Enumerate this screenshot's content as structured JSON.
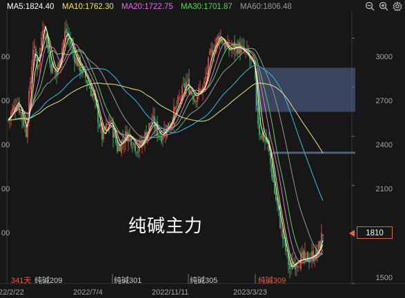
{
  "legend": {
    "ma5": {
      "label": "MA5:1824.40",
      "color": "#ffffff"
    },
    "ma10": {
      "label": "MA10:1762.30",
      "color": "#f5e94e"
    },
    "ma20": {
      "label": "MA20:1722.75",
      "color": "#e46de8"
    },
    "ma30": {
      "label": "MA30:1701.87",
      "color": "#5fd35a"
    },
    "ma60": {
      "label": "MA60:1806.48",
      "color": "#9a9a9a"
    }
  },
  "toolbar": {
    "icons": [
      "zoom-out-icon",
      "zoom-in-icon",
      "settings-icon"
    ]
  },
  "watermark": "纯碱主力",
  "price_tag": "1810",
  "days_label": "341天",
  "contracts": [
    "纯碱209",
    "纯碱301",
    "纯碱305",
    "纯碱309"
  ],
  "colors": {
    "up": "#ff4d4d",
    "down": "#36c66f",
    "highlight": "#f05a3a",
    "ma_long_cyan": "#2fb6d6",
    "ma_long_khaki": "#d9d77a",
    "zone": "#5a6a9a"
  },
  "chart_data": {
    "type": "line",
    "title": "",
    "ylim": [
      1500,
      3150
    ],
    "y_ticks": [
      3000,
      2700,
      2400,
      2100,
      1810,
      1500
    ],
    "y_tick_labels": [
      "3000",
      "2700",
      "2400",
      "2100",
      "1810",
      "1500"
    ],
    "x_tick_labels": [
      "22/2/22",
      "2022/7/4",
      "2022/11/11",
      "2023/3/23"
    ],
    "axis_left_partial_labels": [
      "00",
      "00",
      "00",
      "00",
      "00"
    ],
    "series": [
      {
        "name": "MA5",
        "values": [
          2450,
          2700,
          2900,
          2950,
          2800,
          2600,
          2500,
          2550,
          2650,
          2900,
          2950,
          2900,
          2650,
          2350,
          1650,
          1700,
          1824
        ]
      },
      {
        "name": "MA10",
        "values": [
          2400,
          2650,
          2880,
          2930,
          2820,
          2620,
          2490,
          2540,
          2640,
          2880,
          2940,
          2900,
          2700,
          2400,
          1700,
          1720,
          1762
        ]
      },
      {
        "name": "MA20",
        "values": [
          2350,
          2600,
          2850,
          2900,
          2820,
          2640,
          2480,
          2530,
          2620,
          2850,
          2930,
          2890,
          2750,
          2450,
          1800,
          1700,
          1722
        ]
      },
      {
        "name": "MA30",
        "values": [
          2300,
          2560,
          2800,
          2880,
          2820,
          2660,
          2470,
          2520,
          2600,
          2820,
          2910,
          2880,
          2780,
          2500,
          1850,
          1700,
          1701
        ]
      },
      {
        "name": "MA60",
        "values": [
          2200,
          2450,
          2700,
          2800,
          2800,
          2700,
          2500,
          2500,
          2560,
          2750,
          2880,
          2870,
          2800,
          2600,
          2000,
          1850,
          1806
        ]
      }
    ],
    "zone": {
      "y_range": [
        2550,
        2820
      ],
      "label": ""
    },
    "hline": {
      "y": 2300
    },
    "grid": false,
    "legend_position": "top-left"
  }
}
